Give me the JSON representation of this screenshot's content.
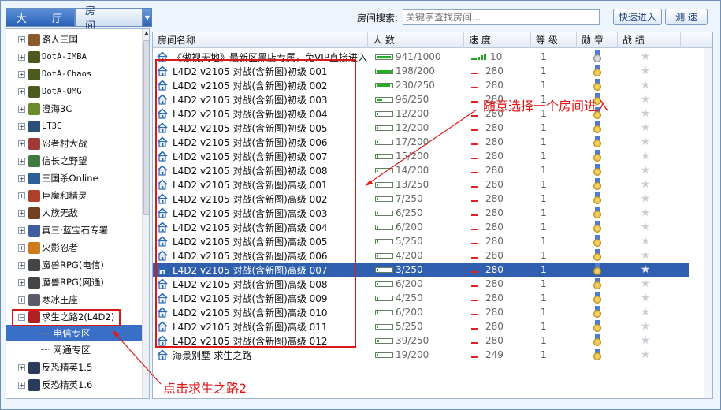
{
  "tabs": {
    "hall": "大 厅",
    "room": "房 间"
  },
  "search": {
    "label": "房间搜索:",
    "placeholder": "关键字查找房间..."
  },
  "buttons": {
    "quick_enter": "快速进入",
    "speed_test": "测 速"
  },
  "tree": {
    "items": [
      {
        "label": "路人三国",
        "icon_color": "#8a5a2b",
        "mono": false
      },
      {
        "label": "DotA-IMBA",
        "icon_color": "#4c5b1d",
        "mono": true
      },
      {
        "label": "DotA-Chaos",
        "icon_color": "#4c5b1d",
        "mono": true
      },
      {
        "label": "DotA-OMG",
        "icon_color": "#4c5b1d",
        "mono": true
      },
      {
        "label": "澄海3C",
        "icon_color": "#6c8b2a",
        "mono": false
      },
      {
        "label": "LT3C",
        "icon_color": "#2c4f7a",
        "mono": true
      },
      {
        "label": "忍者村大战",
        "icon_color": "#a03838",
        "mono": false
      },
      {
        "label": "信长之野望",
        "icon_color": "#3f7a3f",
        "mono": false
      },
      {
        "label": "三国杀Online",
        "icon_color": "#2b5f9a",
        "mono": false
      },
      {
        "label": "巨魔和精灵",
        "icon_color": "#b0402a",
        "mono": false
      },
      {
        "label": "人族无敌",
        "icon_color": "#704020",
        "mono": false
      },
      {
        "label": "真三·蓝宝石专署",
        "icon_color": "#3e5da0",
        "mono": false
      },
      {
        "label": "火影忍者",
        "icon_color": "#d07a1a",
        "mono": false
      },
      {
        "label": "魔兽RPG(电信)",
        "icon_color": "#444444",
        "mono": false
      },
      {
        "label": "魔兽RPG(网通)",
        "icon_color": "#444444",
        "mono": false
      },
      {
        "label": "寒冰王座",
        "icon_color": "#5a5a6a",
        "mono": false
      },
      {
        "label": "求生之路2(L4D2)",
        "icon_color": "#b02020",
        "mono": false,
        "expanded": true
      },
      {
        "label": "反恐精英1.5",
        "icon_color": "#2a3a5a",
        "mono": false
      },
      {
        "label": "反恐精英1.6",
        "icon_color": "#2a3a5a",
        "mono": false
      }
    ],
    "children": [
      {
        "label": "电信专区",
        "selected": true
      },
      {
        "label": "网通专区",
        "selected": false
      }
    ]
  },
  "columns": [
    "房间名称",
    "人 数",
    "速 度",
    "等 级",
    "勋 章",
    "战 绩"
  ],
  "rooms": [
    {
      "name": "《傲视天地》最新区黑店专属，免VIP直接进入",
      "count": "941/1000",
      "fill": 0.94,
      "speed": "10",
      "level": "1",
      "medal": "silver",
      "signal": true
    },
    {
      "name": "L4D2 v2105 对战(含新图)初级 001",
      "count": "198/200",
      "fill": 0.99,
      "speed": "280",
      "level": "1",
      "medal": "gold"
    },
    {
      "name": "L4D2 v2105 对战(含新图)初级 002",
      "count": "230/250",
      "fill": 0.92,
      "speed": "280",
      "level": "1",
      "medal": "gold"
    },
    {
      "name": "L4D2 v2105 对战(含新图)初级 003",
      "count": "96/250",
      "fill": 0.38,
      "speed": "280",
      "level": "1",
      "medal": "gold"
    },
    {
      "name": "L4D2 v2105 对战(含新图)初级 004",
      "count": "12/200",
      "fill": 0.06,
      "speed": "280",
      "level": "1",
      "medal": "gold"
    },
    {
      "name": "L4D2 v2105 对战(含新图)初级 005",
      "count": "12/200",
      "fill": 0.06,
      "speed": "280",
      "level": "1",
      "medal": "gold"
    },
    {
      "name": "L4D2 v2105 对战(含新图)初级 006",
      "count": "17/200",
      "fill": 0.09,
      "speed": "280",
      "level": "1",
      "medal": "gold"
    },
    {
      "name": "L4D2 v2105 对战(含新图)初级 007",
      "count": "15/200",
      "fill": 0.08,
      "speed": "280",
      "level": "1",
      "medal": "gold"
    },
    {
      "name": "L4D2 v2105 对战(含新图)初级 008",
      "count": "14/200",
      "fill": 0.07,
      "speed": "280",
      "level": "1",
      "medal": "gold"
    },
    {
      "name": "L4D2 v2105 对战(含新图)高级 001",
      "count": "13/250",
      "fill": 0.05,
      "speed": "280",
      "level": "1",
      "medal": "gold"
    },
    {
      "name": "L4D2 v2105 对战(含新图)高级 002",
      "count": "7/250",
      "fill": 0.03,
      "speed": "280",
      "level": "1",
      "medal": "gold"
    },
    {
      "name": "L4D2 v2105 对战(含新图)高级 003",
      "count": "6/250",
      "fill": 0.02,
      "speed": "280",
      "level": "1",
      "medal": "gold"
    },
    {
      "name": "L4D2 v2105 对战(含新图)高级 004",
      "count": "6/200",
      "fill": 0.03,
      "speed": "280",
      "level": "1",
      "medal": "gold"
    },
    {
      "name": "L4D2 v2105 对战(含新图)高级 005",
      "count": "5/250",
      "fill": 0.02,
      "speed": "280",
      "level": "1",
      "medal": "gold"
    },
    {
      "name": "L4D2 v2105 对战(含新图)高级 006",
      "count": "4/200",
      "fill": 0.02,
      "speed": "280",
      "level": "1",
      "medal": "gold"
    },
    {
      "name": "L4D2 v2105 对战(含新图)高级 007",
      "count": "3/250",
      "fill": 0.01,
      "speed": "280",
      "level": "1",
      "medal": "gold",
      "selected": true
    },
    {
      "name": "L4D2 v2105 对战(含新图)高级 008",
      "count": "6/200",
      "fill": 0.03,
      "speed": "280",
      "level": "1",
      "medal": "gold"
    },
    {
      "name": "L4D2 v2105 对战(含新图)高级 009",
      "count": "4/250",
      "fill": 0.02,
      "speed": "280",
      "level": "1",
      "medal": "gold"
    },
    {
      "name": "L4D2 v2105 对战(含新图)高级 010",
      "count": "6/200",
      "fill": 0.03,
      "speed": "280",
      "level": "1",
      "medal": "gold"
    },
    {
      "name": "L4D2 v2105 对战(含新图)高级 011",
      "count": "5/250",
      "fill": 0.02,
      "speed": "280",
      "level": "1",
      "medal": "gold"
    },
    {
      "name": "L4D2 v2105 对战(含新图)高级 012",
      "count": "39/250",
      "fill": 0.16,
      "speed": "280",
      "level": "1",
      "medal": "gold"
    },
    {
      "name": "海景别墅-求生之路",
      "count": "19/200",
      "fill": 0.1,
      "speed": "249",
      "level": "1",
      "medal": "gold"
    }
  ],
  "annotations": {
    "select_room": "随意选择一个房间进入",
    "click_l4d2": "点击求生之路2"
  },
  "colors": {
    "accent": "#2f5fae",
    "annotation": "#e01818",
    "signal": "#20a020"
  }
}
